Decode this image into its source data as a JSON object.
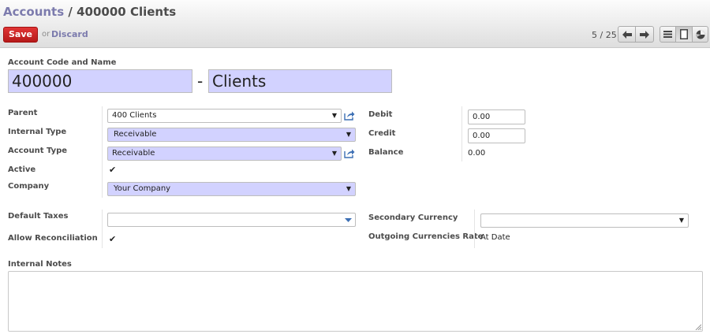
{
  "breadcrumb": {
    "parent": "Accounts",
    "separator": "/",
    "current": "400000 Clients"
  },
  "toolbar": {
    "save_label": "Save",
    "or_label": "or",
    "discard_label": "Discard"
  },
  "pager": {
    "text": "5 / 25"
  },
  "form": {
    "code_name_label": "Account Code and Name",
    "code_value": "400000",
    "dash": "-",
    "name_value": "Clients",
    "parent_label": "Parent",
    "parent_value": "400 Clients",
    "internal_type_label": "Internal Type",
    "internal_type_value": "Receivable",
    "account_type_label": "Account Type",
    "account_type_value": "Receivable",
    "active_label": "Active",
    "active_checked": true,
    "company_label": "Company",
    "company_value": "Your Company",
    "debit_label": "Debit",
    "debit_value": "0.00",
    "credit_label": "Credit",
    "credit_value": "0.00",
    "balance_label": "Balance",
    "balance_value": "0.00",
    "default_taxes_label": "Default Taxes",
    "default_taxes_value": "",
    "allow_reconciliation_label": "Allow Reconciliation",
    "allow_reconciliation_checked": true,
    "secondary_currency_label": "Secondary Currency",
    "secondary_currency_value": "",
    "outgoing_rate_label": "Outgoing Currencies Rate",
    "outgoing_rate_value": "At Date",
    "internal_notes_label": "Internal Notes",
    "internal_notes_value": ""
  },
  "icons": {
    "check": "✔",
    "caret": "▼",
    "prev": "arrow-left-icon",
    "next": "arrow-right-icon",
    "list_view": "list-view-icon",
    "form_view": "form-view-icon",
    "graph_view": "graph-view-icon"
  },
  "colors": {
    "link": "#7c7bad",
    "save_button": "#c92424",
    "required_field": "#d2d2ff"
  }
}
